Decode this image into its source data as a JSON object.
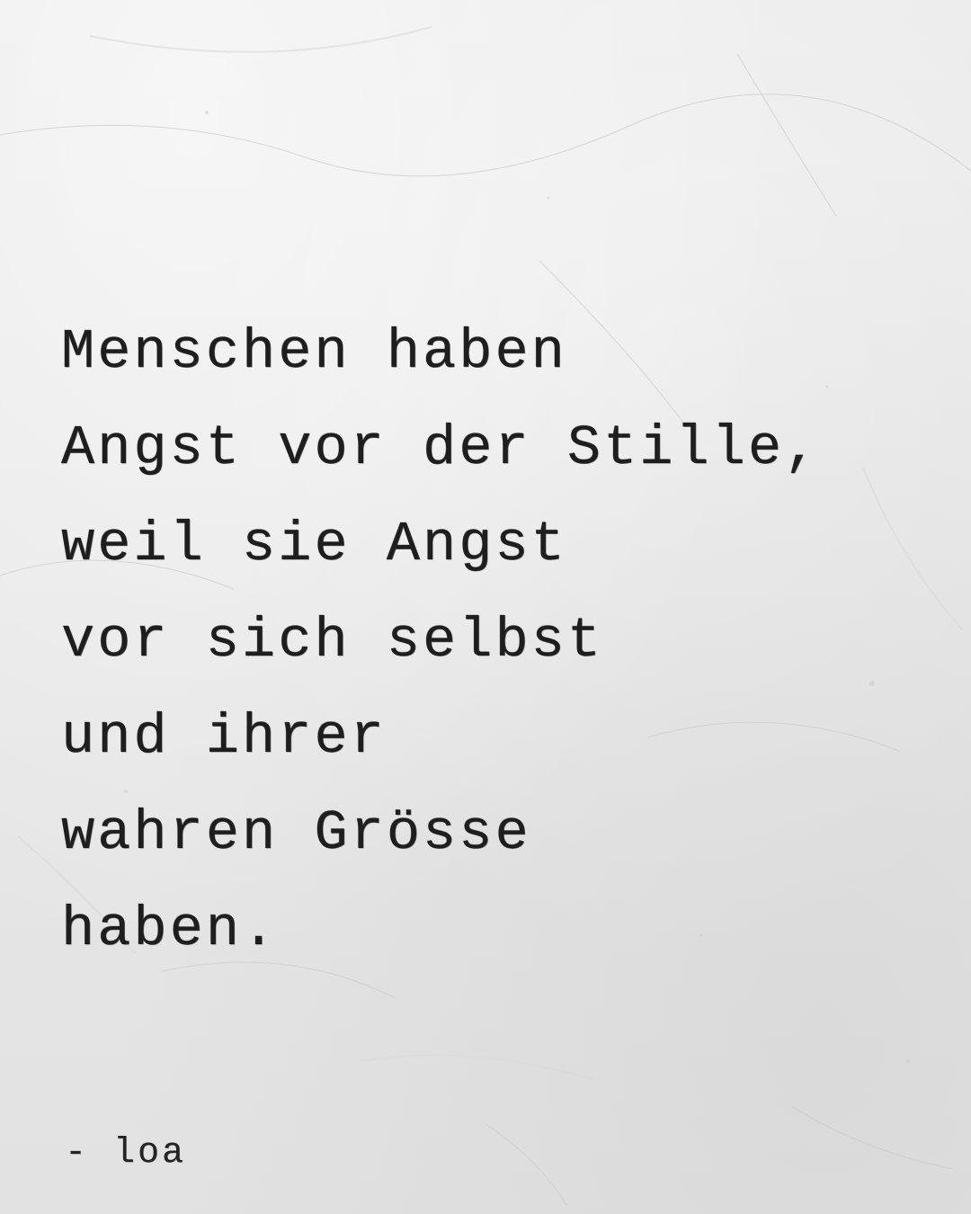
{
  "quote": {
    "lines": [
      "Menschen haben",
      "Angst vor der Stille,",
      "weil sie Angst",
      "vor sich selbst",
      "und ihrer",
      "wahren Grösse",
      "haben."
    ]
  },
  "signature": "- loa",
  "colors": {
    "background": "#e8e8e8",
    "text": "#1e1e1e"
  }
}
